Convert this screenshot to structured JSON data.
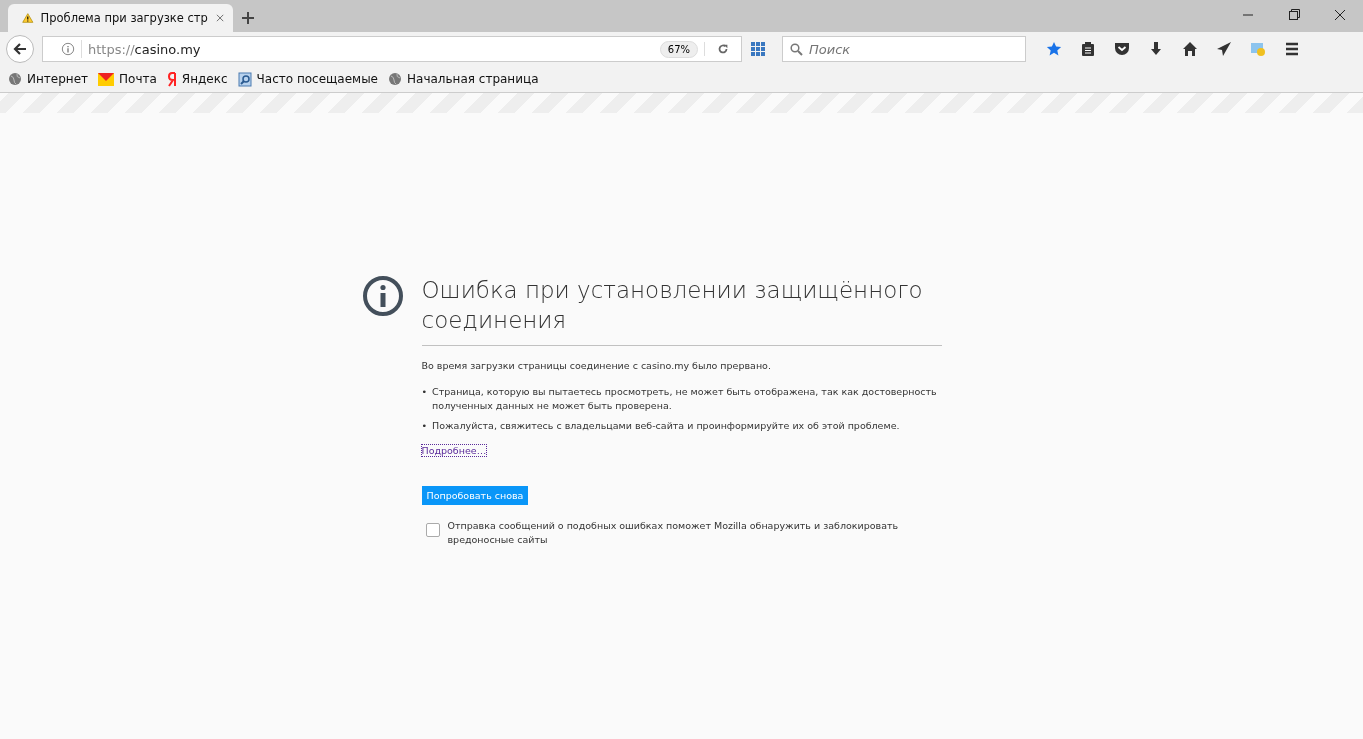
{
  "tab": {
    "title": "Проблема при загрузке стр",
    "selected": true
  },
  "address": {
    "scheme": "https://",
    "host": "casino.my",
    "zoom": "67%"
  },
  "search": {
    "placeholder": "Поиск"
  },
  "bookmarks": [
    {
      "label": "Интернет",
      "kind": "globe"
    },
    {
      "label": "Почта",
      "kind": "mail"
    },
    {
      "label": "Яндекс",
      "kind": "yandex"
    },
    {
      "label": "Часто посещаемые",
      "kind": "folder"
    },
    {
      "label": "Начальная страница",
      "kind": "globe"
    }
  ],
  "error": {
    "title": "Ошибка при установлении защищённого соединения",
    "intro": "Во время загрузки страницы соединение с casino.my было прервано.",
    "bullets": [
      {
        "marker": "•",
        "text": "Страница, которую вы пытаетесь просмотреть, не может быть отображена, так как достоверность полученных данных не может быть проверена."
      },
      {
        "marker": "•",
        "text": "Пожалуйста, свяжитесь с владельцами веб-сайта и проинформируйте их об этой проблеме."
      }
    ],
    "details_link": "Подробнее…",
    "retry_button": "Попробовать снова",
    "report": {
      "label": "Отправка сообщений о подобных ошибках поможет Mozilla обнаружить и заблокировать вредоносные сайты",
      "checked": false
    }
  }
}
